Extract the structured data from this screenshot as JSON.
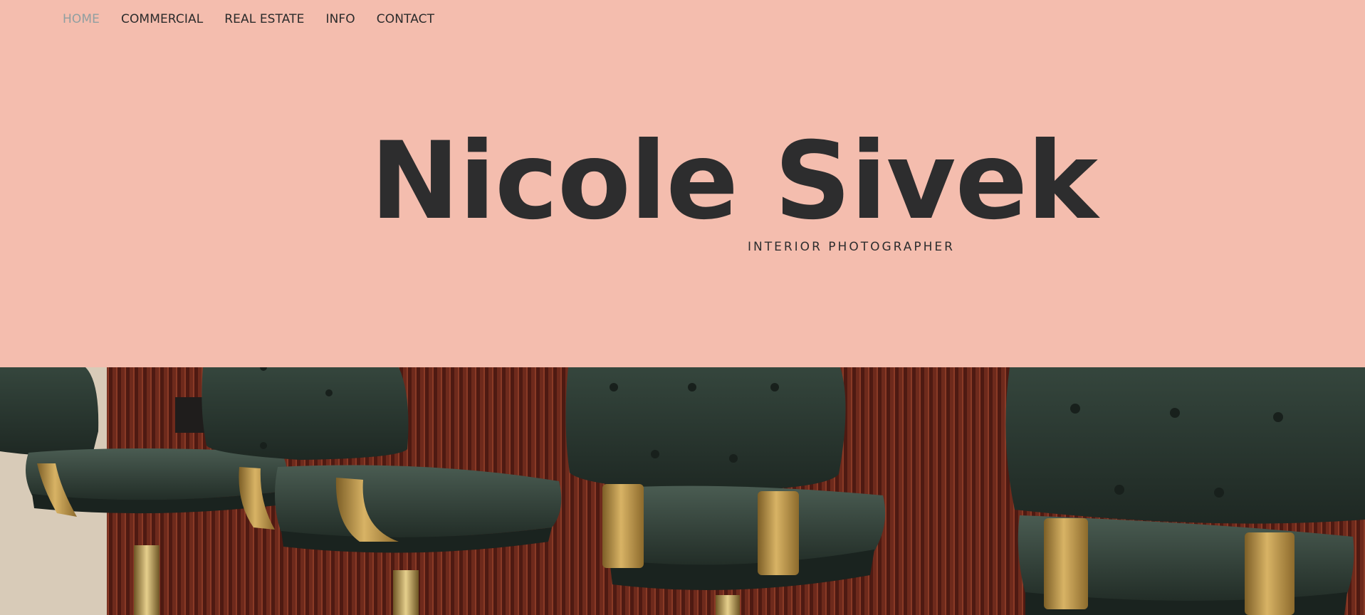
{
  "nav": {
    "items": [
      {
        "label": "HOME",
        "active": true
      },
      {
        "label": "COMMERCIAL",
        "active": false
      },
      {
        "label": "REAL ESTATE",
        "active": false
      },
      {
        "label": "INFO",
        "active": false
      },
      {
        "label": "CONTACT",
        "active": false
      }
    ]
  },
  "hero": {
    "title": "Nicole Sivek",
    "subtitle": "INTERIOR PHOTOGRAPHER"
  },
  "photo": {
    "subject": "green-tufted-leather-bar-stools",
    "colors": {
      "background_header": "#f4bdae",
      "title_text": "#2d2d2e",
      "nav_active": "#8f9fa1",
      "wall": "#5a1e15",
      "leather": "#2c3a33",
      "brass": "#b99449"
    }
  }
}
